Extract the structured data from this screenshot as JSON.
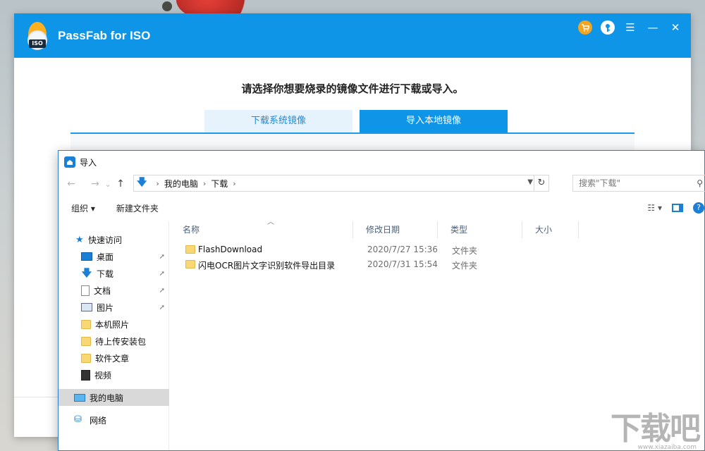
{
  "app": {
    "title": "PassFab for ISO",
    "logo_badge": "ISO",
    "controls": {
      "cart_icon": "cart-icon",
      "key_icon": "key-icon",
      "menu_glyph": "☰",
      "minimize_glyph": "—",
      "close_glyph": "✕"
    },
    "heading": "请选择你想要烧录的镜像文件进行下载或导入。",
    "tabs": [
      {
        "label": "下载系统镜像"
      },
      {
        "label": "导入本地镜像"
      }
    ],
    "colors": {
      "accent": "#0f95e8",
      "cart": "#f3a423"
    }
  },
  "dialog": {
    "title": "导入",
    "nav": {
      "back": "←",
      "forward": "→",
      "recent": "⌄",
      "up": "↑"
    },
    "address": {
      "seg1": "我的电脑",
      "seg2": "下载",
      "arrow": "›",
      "refresh": "↻"
    },
    "search_placeholder": "搜索\"下载\"",
    "toolbar": {
      "organize": "组织 ▾",
      "new_folder": "新建文件夹",
      "view_menu": "☷ ▾",
      "help": "?"
    },
    "sidebar": {
      "quick_access": "快速访问",
      "items": [
        {
          "label": "桌面",
          "pinned": true
        },
        {
          "label": "下载",
          "pinned": true
        },
        {
          "label": "文档",
          "pinned": true
        },
        {
          "label": "图片",
          "pinned": true
        },
        {
          "label": "本机照片",
          "pinned": false
        },
        {
          "label": "待上传安装包",
          "pinned": false
        },
        {
          "label": "软件文章",
          "pinned": false
        },
        {
          "label": "视频",
          "pinned": false
        }
      ],
      "this_pc": "我的电脑",
      "network": "网络",
      "pin_glyph": "📌"
    },
    "columns": [
      "名称",
      "修改日期",
      "类型",
      "大小"
    ],
    "files": [
      {
        "name": "FlashDownload",
        "date": "2020/7/27 15:36",
        "type": "文件夹"
      },
      {
        "name": "闪电OCR图片文字识别软件导出目录",
        "date": "2020/7/31 15:54",
        "type": "文件夹"
      }
    ]
  },
  "watermark": {
    "text": "下载吧",
    "sub": "www.xiazaiba.com"
  }
}
